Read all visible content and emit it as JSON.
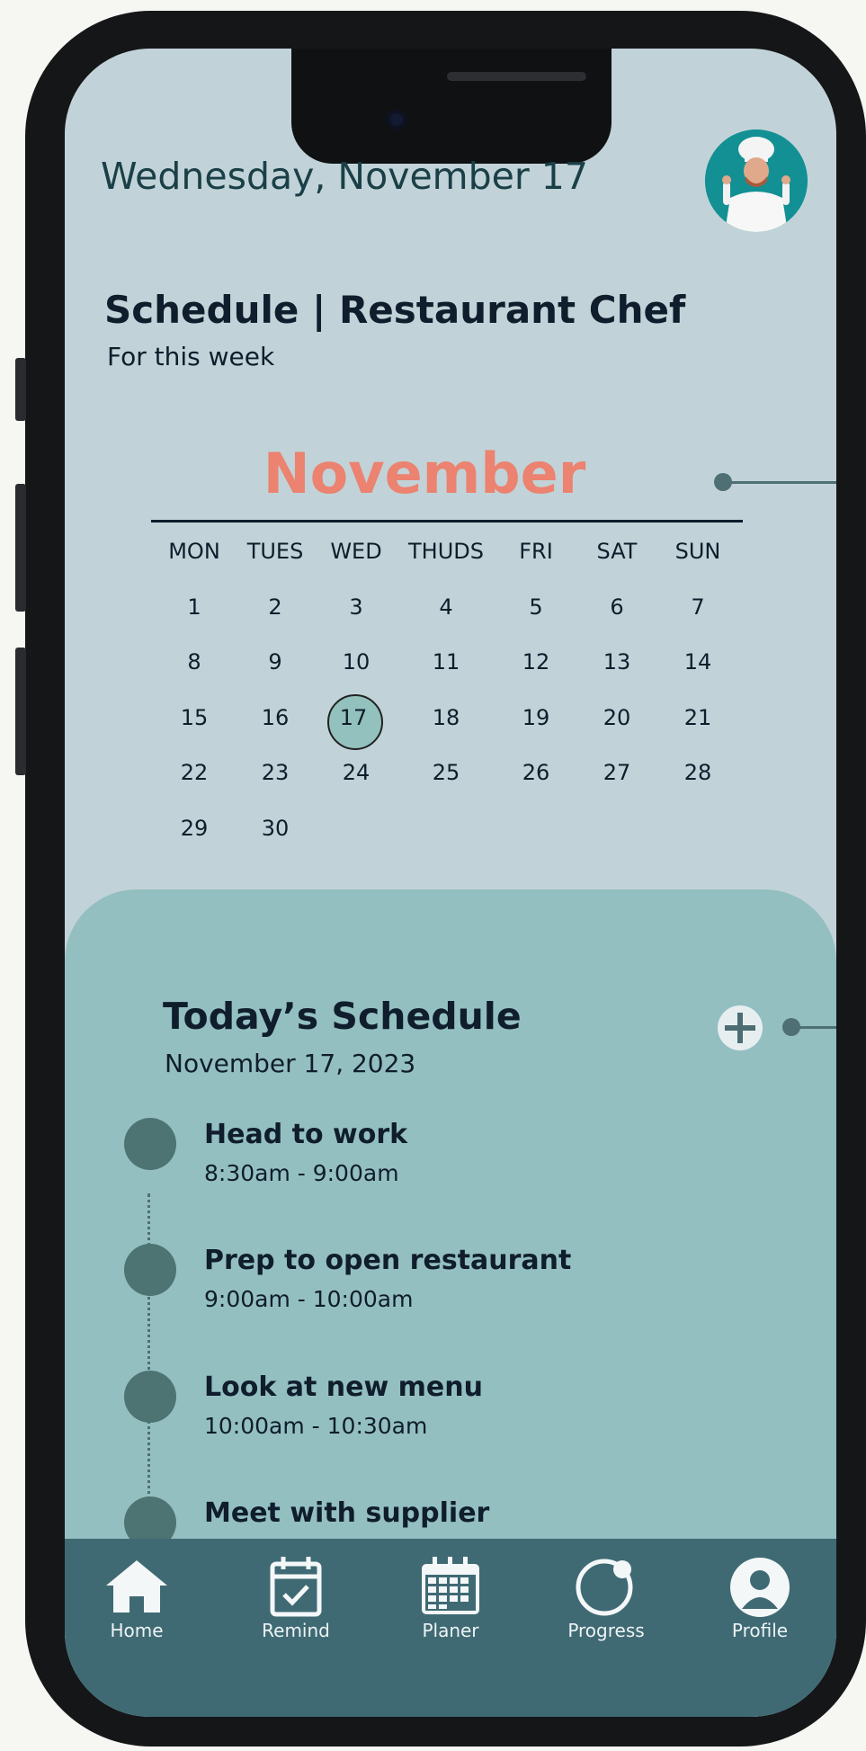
{
  "header": {
    "date": "Wednesday, November 17"
  },
  "page": {
    "title": "Schedule | Restaurant Chef",
    "subtitle": "For this week"
  },
  "calendar": {
    "month": "November",
    "weekdays": [
      "MON",
      "TUES",
      "WED",
      "THUDS",
      "FRI",
      "SAT",
      "SUN"
    ],
    "weeks": [
      [
        "1",
        "2",
        "3",
        "4",
        "5",
        "6",
        "7"
      ],
      [
        "8",
        "9",
        "10",
        "11",
        "12",
        "13",
        "14"
      ],
      [
        "15",
        "16",
        "17",
        "18",
        "19",
        "20",
        "21"
      ],
      [
        "22",
        "23",
        "24",
        "25",
        "26",
        "27",
        "28"
      ],
      [
        "29",
        "30"
      ]
    ],
    "selected_day": "17"
  },
  "today": {
    "title": "Today’s Schedule",
    "date": "November 17, 2023",
    "items": [
      {
        "title": "Head to work",
        "time": "8:30am - 9:00am"
      },
      {
        "title": "Prep to open restaurant",
        "time": "9:00am - 10:00am"
      },
      {
        "title": "Look at new menu",
        "time": "10:00am - 10:30am"
      },
      {
        "title": "Meet with supplier",
        "time": ""
      }
    ]
  },
  "nav": {
    "items": [
      {
        "label": "Home",
        "icon": "home-icon"
      },
      {
        "label": "Remind",
        "icon": "calendar-check-icon"
      },
      {
        "label": "Planer",
        "icon": "calendar-grid-icon"
      },
      {
        "label": "Progress",
        "icon": "progress-ring-icon"
      },
      {
        "label": "Profile",
        "icon": "user-icon"
      }
    ]
  },
  "colors": {
    "background": "#c1d3d8",
    "accent_month": "#ec8270",
    "schedule_panel": "#94bfc0",
    "nav_bar": "#3f6a74"
  }
}
